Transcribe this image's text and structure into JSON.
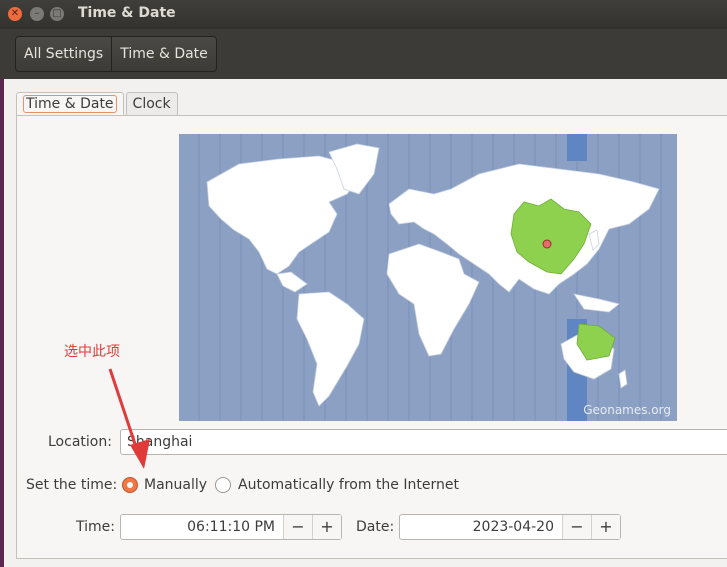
{
  "window": {
    "title": "Time & Date"
  },
  "toolbar": {
    "crumbs": [
      "All Settings",
      "Time & Date"
    ]
  },
  "tabs": [
    "Time & Date",
    "Clock"
  ],
  "map": {
    "credit": "Geonames.org",
    "highlight_color": "#8dd14f",
    "timezone_band_color": "#5f86c2"
  },
  "location": {
    "label": "Location:",
    "value": "Shanghai"
  },
  "set_time": {
    "label": "Set the time:",
    "options": [
      "Manually",
      "Automatically from the Internet"
    ],
    "selected": "Manually"
  },
  "time": {
    "label": "Time:",
    "value": "06:11:10 PM",
    "minus": "−",
    "plus": "+"
  },
  "date": {
    "label": "Date:",
    "value": "2023-04-20",
    "minus": "−",
    "plus": "+"
  },
  "annotation": {
    "text": "选中此项"
  },
  "colors": {
    "accent": "#f07746",
    "annotation": "#e03a3a"
  }
}
